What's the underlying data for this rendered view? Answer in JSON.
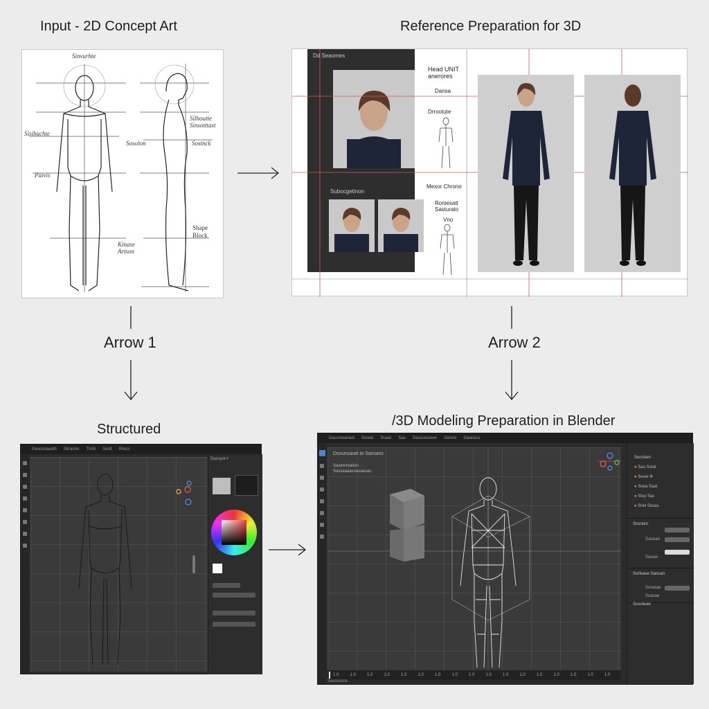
{
  "titles": {
    "input": "Input - 2D Concept Art",
    "reference": "Reference Preparation for 3D",
    "structured": "Structured",
    "blender": "/3D Modeling Preparation in Blender"
  },
  "arrows": {
    "arrow1": "Arrow 1",
    "arrow2": "Arrow 2"
  },
  "sketch": {
    "labels": [
      "Sinvurhte",
      "Silhoutte Sinsotttast",
      "Sisibachte",
      "Sosolon",
      "Sostnck",
      "Paivis",
      "Shape Block",
      "Kinase Artson"
    ]
  },
  "reference_sheet": {
    "labels": [
      "Head UNIT anerores",
      "Dansa",
      "Drrootute",
      "Mexor Chrono",
      "Roniesatt Sasturato",
      "Vno",
      "Subocgetinon"
    ],
    "top_label": "Dd Seaomes"
  },
  "structured_app": {
    "menu": [
      "Gesosoaaath",
      "Sirrannn",
      "Trmh",
      "Sestt",
      "Rrecs"
    ],
    "side_header": "Dassyor-I"
  },
  "blender_app": {
    "menu": [
      "Dassmeaneet",
      "Soreio",
      "Sraan",
      "Sas",
      "Sasoonsoeer",
      "Gemre",
      "Gaaness"
    ],
    "view_header": "Dssuesaset to Sassass",
    "view_items": [
      "Sasemmation",
      "Sasseaaasnasaesas"
    ],
    "outliner_header": "Sorctsen",
    "outliner": [
      "Sau Sotat",
      "Seuw 4l",
      "Soea Saat",
      "Stuy Sas",
      "Sriel Sosas"
    ],
    "props": {
      "section1": "Sosrasn",
      "row1": "Gasean",
      "row2": "Sasow",
      "section2": "Surfoase Saosan",
      "row3": "Sosarae",
      "row4": "Soasae",
      "section3": "Sosolwan"
    },
    "timeline": [
      "1.0",
      "1.0",
      "1.0",
      "1.0",
      "1.0",
      "1.0",
      "1.0",
      "1.0",
      "1.0",
      "1.0",
      "1.0",
      "1.0",
      "1.0",
      "1.0",
      "1.0",
      "1.0",
      "1.0"
    ],
    "status": "Sasssosns"
  },
  "colors": {
    "background": "#ececec",
    "app_dark": "#2b2b2b",
    "viewport": "#3a3a3a",
    "guide_red": "#d85a4a",
    "accent_blue": "#4d86c8"
  }
}
